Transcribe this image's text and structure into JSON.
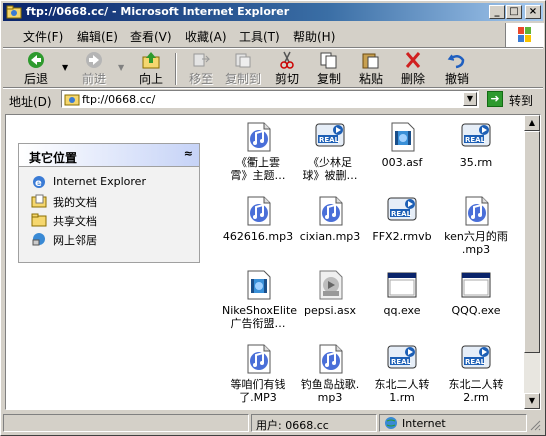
{
  "window": {
    "title": "ftp://0668.cc/ - Microsoft Internet Explorer"
  },
  "menu": [
    "文件(F)",
    "编辑(E)",
    "查看(V)",
    "收藏(A)",
    "工具(T)",
    "帮助(H)"
  ],
  "toolbar": {
    "back": "后退",
    "forward": "前进",
    "up": "向上",
    "move_to": "移至",
    "copy_to": "复制到",
    "cut": "剪切",
    "copy": "复制",
    "paste": "粘贴",
    "delete": "删除",
    "undo": "撤销"
  },
  "address": {
    "label": "地址(D)",
    "value": "ftp://0668.cc/",
    "go": "转到"
  },
  "panel": {
    "title": "其它位置",
    "collapse": "≈",
    "links": [
      "Internet Explorer",
      "我的文档",
      "共享文档",
      "网上邻居"
    ]
  },
  "files": [
    {
      "name": "《衢上雲\n霄》主题…",
      "type": "mp3"
    },
    {
      "name": "《少林足\n球》被删…",
      "type": "real"
    },
    {
      "name": "003.asf",
      "type": "asf"
    },
    {
      "name": "35.rm",
      "type": "real"
    },
    {
      "name": "462616.mp3",
      "type": "mp3"
    },
    {
      "name": "cixian.mp3",
      "type": "mp3"
    },
    {
      "name": "FFX2.rmvb",
      "type": "real"
    },
    {
      "name": "ken六月的雨\n.mp3",
      "type": "mp3"
    },
    {
      "name": "NikeShoxElite\n广告衔盟…",
      "type": "asf"
    },
    {
      "name": "pepsi.asx",
      "type": "asx"
    },
    {
      "name": "qq.exe",
      "type": "exe"
    },
    {
      "name": "QQQ.exe",
      "type": "exe"
    },
    {
      "name": "等咱们有钱\n了.MP3",
      "type": "mp3"
    },
    {
      "name": "钓鱼岛战歌.\nmp3",
      "type": "mp3"
    },
    {
      "name": "东北二人转\n1.rm",
      "type": "real"
    },
    {
      "name": "东北二人转\n2.rm",
      "type": "real"
    }
  ],
  "status": {
    "user": "用户: 0668.cc",
    "zone": "Internet"
  }
}
